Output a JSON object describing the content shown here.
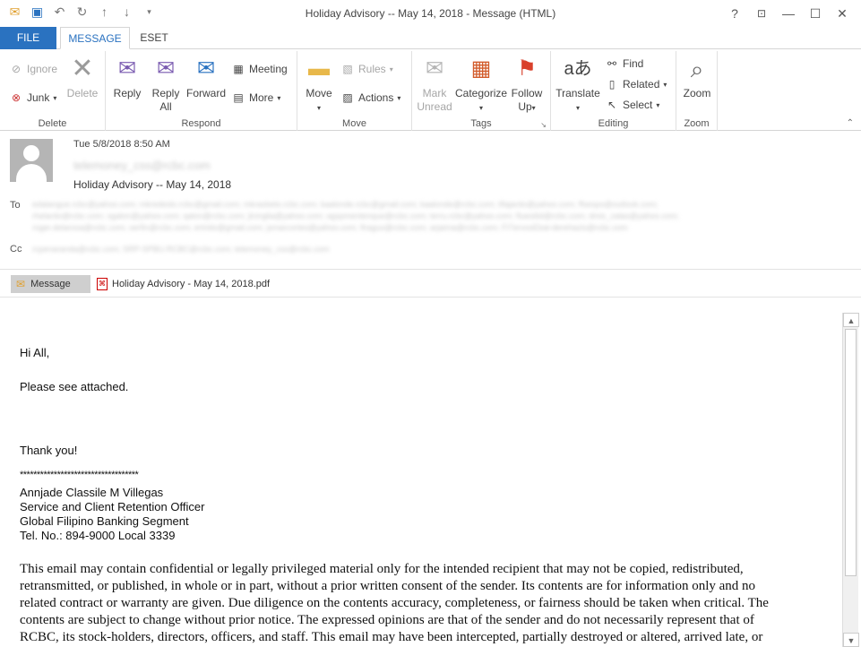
{
  "window": {
    "title": "Holiday Advisory -- May 14, 2018 - Message (HTML)"
  },
  "tabs": [
    "FILE",
    "MESSAGE",
    "ESET"
  ],
  "ribbon": {
    "delete": {
      "label": "Delete",
      "ignore": "Ignore",
      "junk": "Junk",
      "delete": "Delete"
    },
    "respond": {
      "label": "Respond",
      "reply": "Reply",
      "reply_all_1": "Reply",
      "reply_all_2": "All",
      "forward": "Forward",
      "meeting": "Meeting",
      "more": "More"
    },
    "move": {
      "label": "Move",
      "move": "Move",
      "rules": "Rules",
      "actions": "Actions"
    },
    "tags": {
      "label": "Tags",
      "mark_unread_1": "Mark",
      "mark_unread_2": "Unread",
      "categorize": "Categorize",
      "follow_up_1": "Follow",
      "follow_up_2": "Up"
    },
    "editing": {
      "label": "Editing",
      "translate": "Translate",
      "find": "Find",
      "related": "Related",
      "select": "Select"
    },
    "zoom": {
      "label": "Zoom",
      "zoom": "Zoom"
    }
  },
  "header": {
    "date": "Tue 5/8/2018 8:50 AM",
    "from": "telemoney_css@rcbc.com",
    "subject": "Holiday Advisory -- May 14, 2018",
    "to_label": "To",
    "to_line1": "edalangue.rcbc@yahoo.com; mkredeslo.rcbc@gmail.com; mkrasbeto.rcbc.com; kaalonde.rcbc@gmail.com; kaalonde@rcbc.com; ilfajardo@yahoo.com; ffsesps@outlook.com;",
    "to_line2": "rhelardo@rcbc.com; sgalon@yahoo.com; qalon@rcbc.com; jlcinglia@yahoo.com; agspmentenque@rcbc.com; terru.rcbc@yahoo.com; fluesitid@rcbc.com; dmis_zalas@yahoo.com;",
    "to_line3": "roger.delarosa@rcbc.com; serfin@rcbc.com; ertrido@gmail.com; jsmarcortes@yahoo.com; flragus@rcbc.com; arjaima@rcbc.com; FI7ervosEbal-derehazis@rcbc.com",
    "cc_label": "Cc",
    "cc_line": "rcpenaranda@rcbc.com; SRP-SPBU.RCBC@rcbc.com; telemoney_css@rcbc.com"
  },
  "attachments": {
    "message": "Message",
    "file": "Holiday Advisory - May 14, 2018.pdf"
  },
  "body": {
    "greeting": "Hi All,",
    "line1": "Please see attached.",
    "thanks": "Thank you!",
    "stars": "***********************************",
    "sig1": "Annjade Classile M Villegas",
    "sig2": "Service and Client Retention Officer",
    "sig3": "Global Filipino Banking Segment",
    "sig4": "Tel. No.: 894-9000 Local 3339",
    "d1": "This email may contain confidential or legally privileged material only for the intended recipient that may not be copied, redistributed,",
    "d2": "retransmitted, or published, in whole or in part, without a prior written consent of the sender. Its contents are for information only and no",
    "d3": "related contract or warranty are given. Due diligence on the contents accuracy, completeness, or fairness should be taken when critical. The",
    "d4": "contents are subject to change without prior notice. The expressed opinions are that of the sender and do not necessarily represent that of",
    "d5": "RCBC, its stock-holders, directors, officers, and staff. This email may have been intercepted, partially destroyed or altered, arrived late, or"
  },
  "colors": {
    "accent": "#2a72c0",
    "pdf": "#cc0000"
  }
}
